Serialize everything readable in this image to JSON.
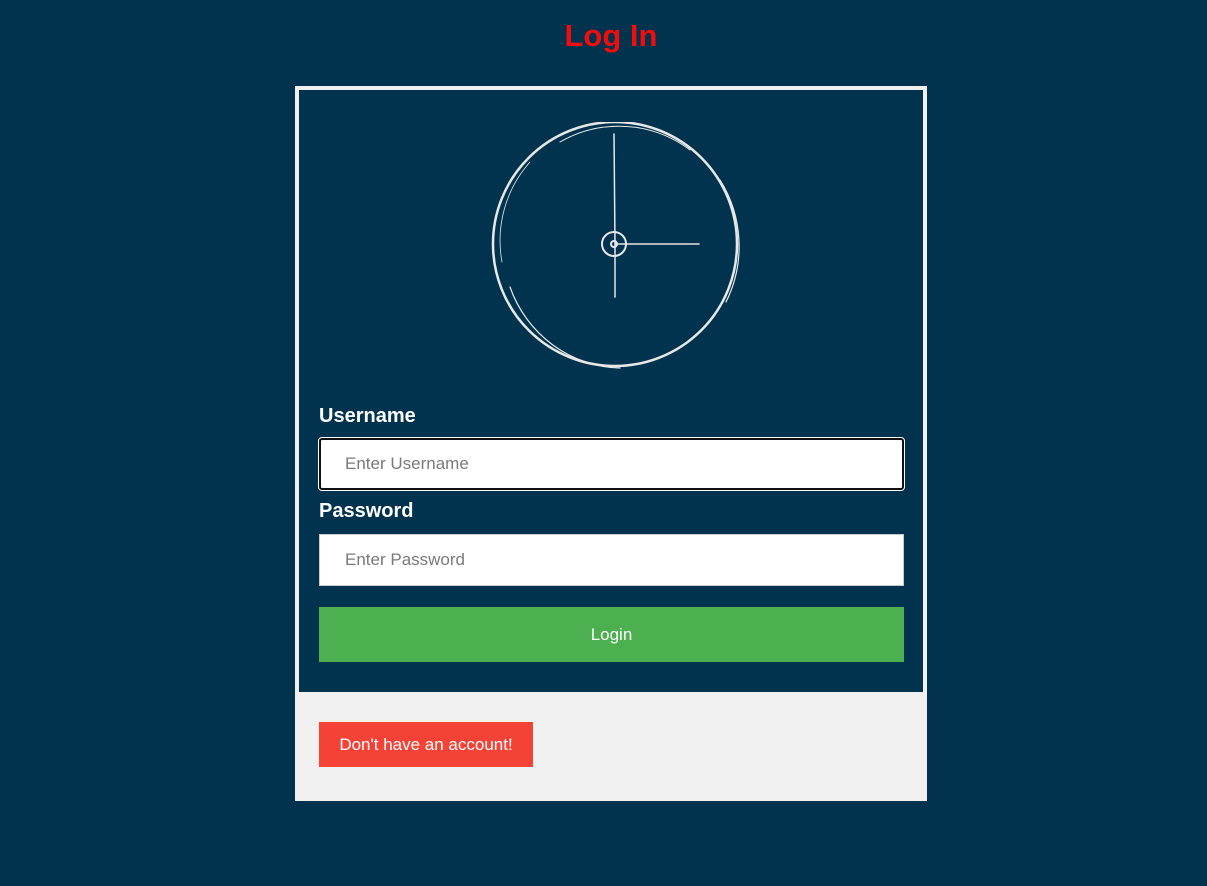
{
  "page": {
    "title": "Log In"
  },
  "form": {
    "avatar_icon": "clock-icon",
    "username_label": "Username",
    "username_placeholder": "Enter Username",
    "username_value": "",
    "password_label": "Password",
    "password_placeholder": "Enter Password",
    "password_value": "",
    "login_label": "Login"
  },
  "footer": {
    "signup_label": "Don't have an account!"
  },
  "colors": {
    "background": "#01334f",
    "title": "#f20d0d",
    "login_button": "#4caf50",
    "signup_button": "#f44336",
    "card_border": "#f1f1f1"
  }
}
